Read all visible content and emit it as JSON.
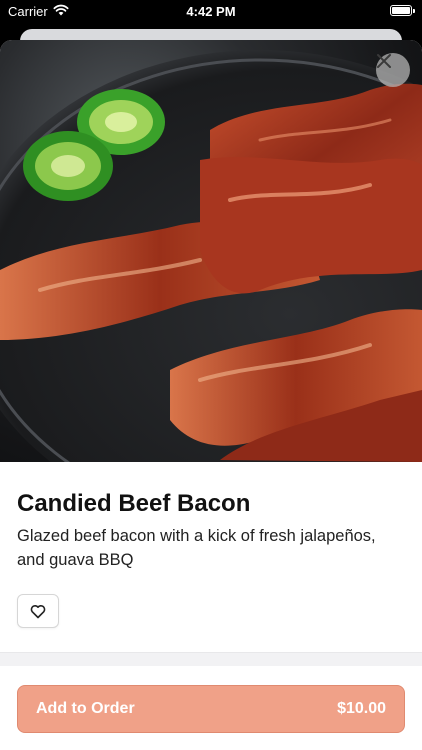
{
  "status_bar": {
    "carrier": "Carrier",
    "time": "4:42 PM",
    "battery_level": 1.0
  },
  "hero": {
    "image_subject": "candied beef bacon with jalapeño slices on a dark plate",
    "close_icon": "close-icon"
  },
  "item": {
    "title": "Candied Beef Bacon",
    "description": "Glazed beef bacon with a kick of fresh jalapeños, and guava BBQ"
  },
  "actions": {
    "favorite_icon": "heart-outline-icon",
    "add_to_order_label": "Add to Order",
    "price": "$10.00"
  },
  "colors": {
    "accent": "#f0a188",
    "accent_border": "#e08a70",
    "text_primary": "#111111"
  }
}
